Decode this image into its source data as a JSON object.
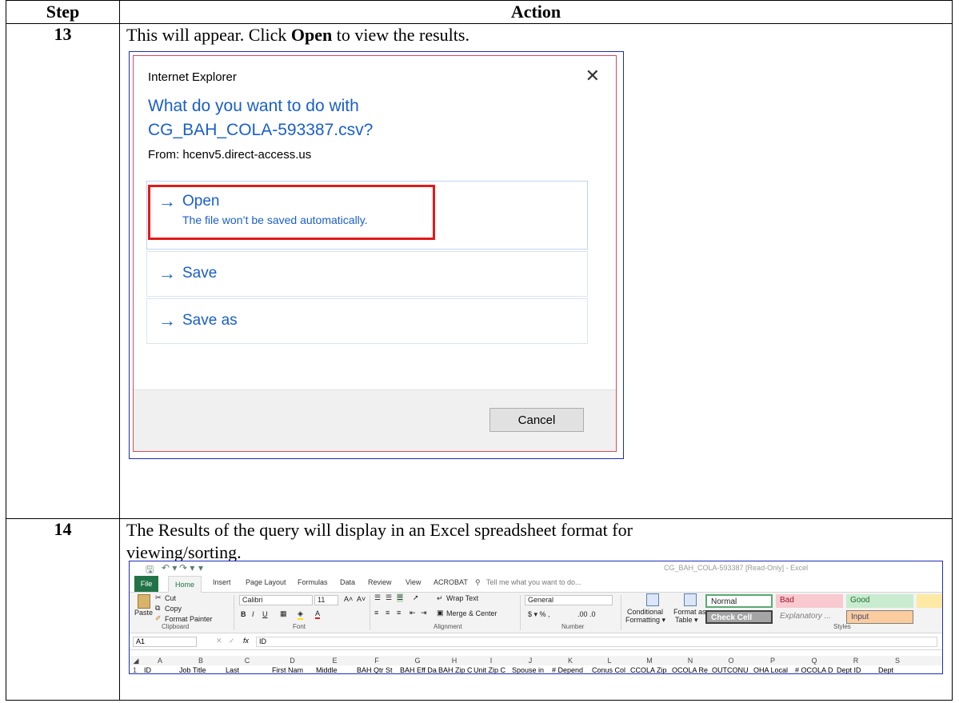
{
  "table": {
    "header_step": "Step",
    "header_action": "Action"
  },
  "step13": {
    "number": "13",
    "instruction_pre": "This will appear. Click ",
    "instruction_bold": "Open",
    "instruction_post": " to view the results."
  },
  "ie_dialog": {
    "title": "Internet Explorer",
    "close_glyph": "✕",
    "question_line1": "What do you want to do with",
    "question_line2": "CG_BAH_COLA-593387.csv?",
    "from": "From: hcenv5.direct-access.us",
    "arrow_glyph": "→",
    "option_open_label": "Open",
    "option_open_sub": "The file won’t be saved automatically.",
    "option_save_label": "Save",
    "option_saveas_label": "Save as",
    "cancel_label": "Cancel",
    "highlight_color": "#e21a1a",
    "link_color": "#1a5fc8"
  },
  "step14": {
    "number": "14",
    "instruction_line1": "The Results of the query will display in an Excel spreadsheet format for",
    "instruction_line2": "viewing/sorting."
  },
  "excel": {
    "qat_save": "🖫",
    "qat_undo": "↶ ▾",
    "qat_redo": "↷ ▾",
    "qat_more": "▾",
    "window_title": "CG_BAH_COLA-593387 [Read-Only] - Excel",
    "tabs": [
      "File",
      "Home",
      "Insert",
      "Page Layout",
      "Formulas",
      "Data",
      "Review",
      "View",
      "ACROBAT"
    ],
    "tell_me": "Tell me what you want to do...",
    "clipboard": {
      "paste": "Paste",
      "cut": "Cut",
      "copy": "Copy",
      "format_painter": "Format Painter",
      "label": "Clipboard"
    },
    "font": {
      "name": "Calibri",
      "size": "11",
      "bold": "B",
      "italic": "I",
      "underline": "U",
      "grow": "A˄",
      "shrink": "A˅",
      "label": "Font"
    },
    "alignment": {
      "wrap_text": "Wrap Text",
      "merge_center": "Merge & Center",
      "label": "Alignment"
    },
    "number": {
      "format": "General",
      "currency": "$ ▾ % ,",
      "decimals": ".00 .0",
      "label": "Number"
    },
    "styles": {
      "conditional_formatting_line1": "Conditional",
      "conditional_formatting_line2": "Formatting ▾",
      "format_as_table_line1": "Format as",
      "format_as_table_line2": "Table ▾",
      "normal": "Normal",
      "bad": "Bad",
      "good": "Good",
      "check_cell": "Check Cell",
      "explanatory": "Explanatory ...",
      "input": "Input",
      "label": "Styles",
      "normal_border": "#5aa972",
      "bad_bg": "#f8c9cf",
      "bad_fg": "#9c1a26",
      "good_bg": "#c9ebcf",
      "good_fg": "#1f6d2f",
      "check_bg": "#a5a5a5",
      "input_bg": "#fbcd9e"
    },
    "name_box": "A1",
    "fx": "fx",
    "formula": "ID",
    "columns": [
      "A",
      "B",
      "C",
      "D",
      "E",
      "F",
      "G",
      "H",
      "I",
      "J",
      "K",
      "L",
      "M",
      "N",
      "O",
      "P",
      "Q",
      "R",
      "S"
    ],
    "row_number": "1",
    "row1": [
      "ID",
      "Job Title",
      "Last",
      "First Nam",
      "Middle",
      "BAH Qtr St",
      "BAH Eff Da",
      "BAH Zip C",
      "Unit Zip C",
      "Spouse in",
      "# Depend",
      "Conus Col",
      "CCOLA Zip",
      "OCOLA Re",
      "OUTCONU",
      "OHA Local",
      "# OCOLA D",
      "Dept ID",
      "Dept"
    ]
  }
}
